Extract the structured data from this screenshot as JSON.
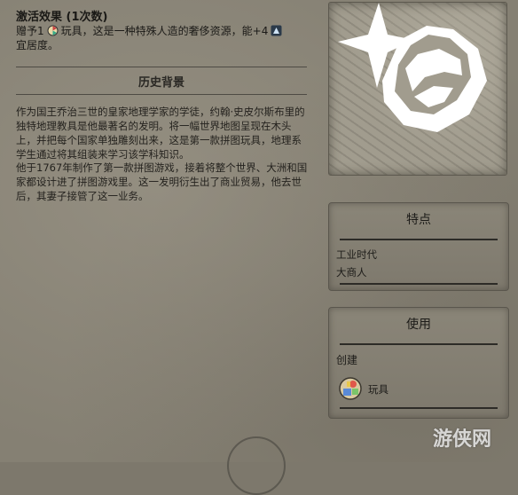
{
  "effect": {
    "title": "激活效果 (1次数)",
    "grant_prefix": "赠予1",
    "grant_item": "玩具，这是一种特殊人造的奢侈资源，能+4",
    "line2": "宜居度。"
  },
  "history": {
    "heading": "历史背景",
    "paragraph1": "作为国王乔治三世的皇家地理学家的学徒，约翰·史皮尔斯布里的独特地理教具是他最著名的发明。将一幅世界地图呈现在木头上，并把每个国家单独雕刻出来，这是第一款拼图玩具，地理系学生通过将其组装来学习该学科知识。",
    "paragraph2": "他于1767年制作了第一款拼图游戏，接着将整个世界、大洲和国家都设计进了拼图游戏里。这一发明衍生出了商业贸易，他去世后，其妻子接管了这一业务。"
  },
  "traits": {
    "title": "特点",
    "items": [
      "工业时代",
      "大商人"
    ]
  },
  "usage": {
    "title": "使用",
    "create_label": "创建",
    "item_label": "玩具"
  },
  "watermark": "游侠网",
  "icons": {
    "toy": "toy-icon",
    "amenity": "amenity-icon",
    "portrait": "gem-sparkle-icon",
    "compass": "compass-icon"
  }
}
